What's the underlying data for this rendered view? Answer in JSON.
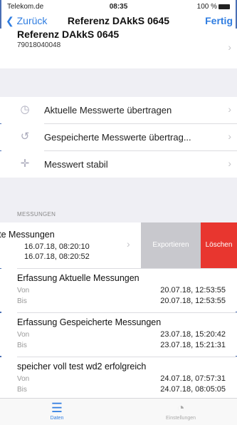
{
  "status_bar": {
    "carrier": "Telekom.de",
    "time": "08:35",
    "battery": "100 %"
  },
  "nav": {
    "back_label": "Zurück",
    "title": "Referenz DAkkS 0645",
    "done_label": "Fertig"
  },
  "device": {
    "name": "Referenz DAkkS 0645",
    "serial": "79018040048"
  },
  "actions": [
    {
      "label": "Aktuelle Messwerte übertragen",
      "icon": "clock-icon"
    },
    {
      "label": "Gespeicherte Messwerte übertrag...",
      "icon": "history-icon"
    },
    {
      "label": "Messwert stabil",
      "icon": "crosshair-icon"
    }
  ],
  "section_title": "MESSUNGEN",
  "swipe_row": {
    "title": "rte Messungen",
    "from": "16.07.18, 08:20:10",
    "to": "16.07.18, 08:20:52",
    "export_label": "Exportieren",
    "delete_label": "Löschen"
  },
  "measurements": [
    {
      "title": "Erfassung Aktuelle Messungen",
      "from_label": "Von",
      "from": "20.07.18, 12:53:55",
      "to_label": "Bis",
      "to": "20.07.18, 12:53:55"
    },
    {
      "title": "Erfassung Gespeicherte Messungen",
      "from_label": "Von",
      "from": "23.07.18, 15:20:42",
      "to_label": "Bis",
      "to": "23.07.18, 15:21:31"
    },
    {
      "title": "speicher voll test wd2 erfolgreich",
      "from_label": "Von",
      "from": "24.07.18, 07:57:31",
      "to_label": "Bis",
      "to": "24.07.18, 08:05:05"
    }
  ],
  "tabs": [
    {
      "label": "Daten",
      "icon": "list-icon",
      "active": true
    },
    {
      "label": "Einstellungen",
      "icon": "gauge-icon",
      "active": false
    }
  ],
  "colors": {
    "accent": "#2f7de1",
    "delete": "#e8362f",
    "export": "#c8c8cd"
  }
}
